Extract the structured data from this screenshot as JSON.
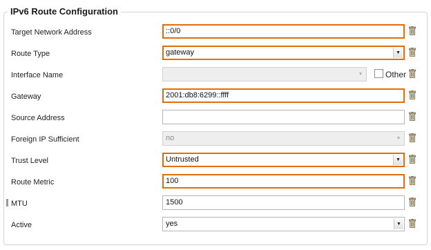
{
  "form": {
    "title": "IPv6 Route Configuration",
    "fields": [
      {
        "label": "Target Network Address",
        "value": "::0/0"
      },
      {
        "label": "Route Type",
        "value": "gateway"
      },
      {
        "label": "Interface Name",
        "value": "",
        "checkbox_label": "Other"
      },
      {
        "label": "Gateway",
        "value": "2001:db8:6299::ffff"
      },
      {
        "label": "Source Address",
        "value": ""
      },
      {
        "label": "Foreign IP Sufficient",
        "value": "no"
      },
      {
        "label": "Trust Level",
        "value": "Untrusted"
      },
      {
        "label": "Route Metric",
        "value": "100"
      },
      {
        "label": "MTU",
        "value": "1500"
      },
      {
        "label": "Active",
        "value": "yes"
      }
    ]
  },
  "colors": {
    "highlight_border": "#e36c09",
    "disabled_bg": "#eeeeee"
  },
  "icons": {
    "delete": "trash-icon",
    "dropdown": "chevron-down-icon"
  }
}
